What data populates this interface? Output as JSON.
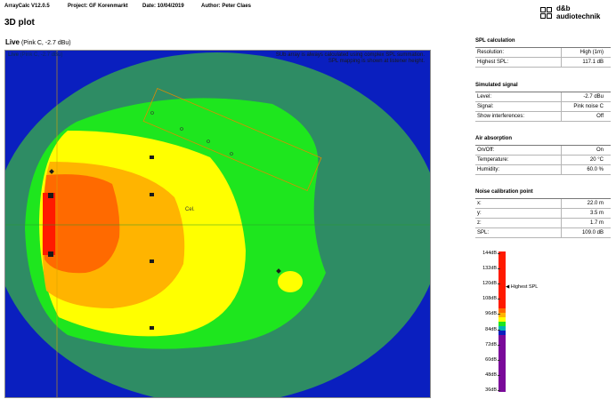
{
  "header": {
    "app": "ArrayCalc V12.0.5",
    "project": "Project: GF Korenmarkt",
    "date": "Date: 10/04/2019",
    "author": "Author: Peter Claes"
  },
  "logo": {
    "line1": "d&b",
    "line2": "audiotechnik"
  },
  "page_title": "3D plot",
  "live": {
    "label": "Live",
    "signal": "(Pink C, -2.7 dBu)"
  },
  "plot": {
    "live_label": "Live",
    "live_signal": "(Pink C, -2.7 dBu)",
    "note_line1": "SUb array is always calculated using complex SPL summation.",
    "note_line2": "SPL mapping is shown at listener height.",
    "cel_label": "Cel."
  },
  "sections": [
    {
      "title": "SPL calculation",
      "rows": [
        {
          "key": "Resolution:",
          "value": "High (1m)"
        },
        {
          "key": "Highest SPL:",
          "value": "117.1 dB"
        }
      ]
    },
    {
      "title": "Simulated signal",
      "rows": [
        {
          "key": "Level:",
          "value": "-2.7 dBu"
        },
        {
          "key": "Signal:",
          "value": "Pink noise C"
        },
        {
          "key": "Show interferences:",
          "value": "Off"
        }
      ]
    },
    {
      "title": "Air absorption",
      "rows": [
        {
          "key": "On/Off:",
          "value": "On"
        },
        {
          "key": "Temperature:",
          "value": "20 °C"
        },
        {
          "key": "Humidity:",
          "value": "60.0 %"
        }
      ]
    },
    {
      "title": "Noise calibration point",
      "rows": [
        {
          "key": "x:",
          "value": "22.0 m"
        },
        {
          "key": "y:",
          "value": "3.5 m"
        },
        {
          "key": "z:",
          "value": "1.7 m"
        },
        {
          "key": "SPL:",
          "value": "109.0 dB"
        }
      ]
    }
  ],
  "scale": {
    "ticks": [
      "144dB",
      "132dB",
      "120dB",
      "108dB",
      "96dB",
      "84dB",
      "72dB",
      "60dB",
      "48dB",
      "36dB"
    ],
    "highest_label": "Highest SPL",
    "highest_value_db": 117.1
  },
  "colors": {
    "red": "#ff1a00",
    "orange": "#ff6a00",
    "amber": "#ffb400",
    "yellow": "#ffff00",
    "green": "#1ee61e",
    "teal": "#2e8c64",
    "purple": "#7a0a9a",
    "blue": "#0a1fbf"
  }
}
